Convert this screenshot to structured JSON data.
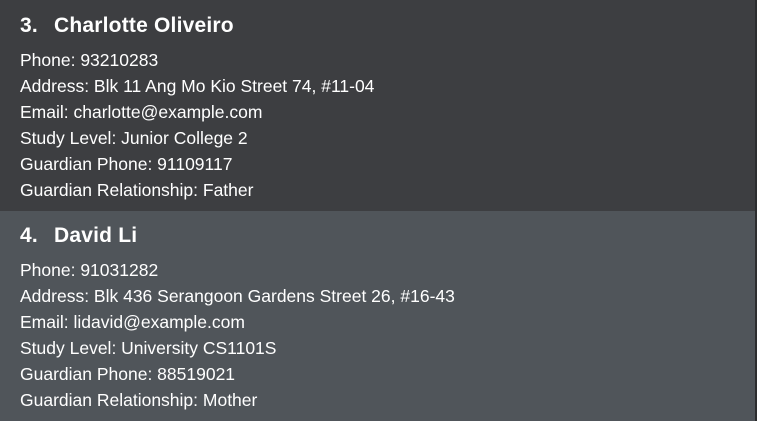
{
  "persons": [
    {
      "index": "3.",
      "name": "Charlotte Oliveiro",
      "phone": "Phone: 93210283",
      "address": "Address: Blk 11 Ang Mo Kio Street 74, #11-04",
      "email": "Email: charlotte@example.com",
      "study_level": "Study Level: Junior College 2",
      "guardian_phone": "Guardian Phone: 91109117",
      "guardian_relationship": "Guardian Relationship: Father"
    },
    {
      "index": "4.",
      "name": "David Li",
      "phone": "Phone: 91031282",
      "address": "Address: Blk 436 Serangoon Gardens Street 26, #16-43",
      "email": "Email: lidavid@example.com",
      "study_level": "Study Level: University CS1101S",
      "guardian_phone": "Guardian Phone: 88519021",
      "guardian_relationship": "Guardian Relationship: Mother"
    }
  ],
  "colors": {
    "card_bg": "#3d3e41",
    "card_selected_bg": "#50555a",
    "text": "#ffffff"
  }
}
